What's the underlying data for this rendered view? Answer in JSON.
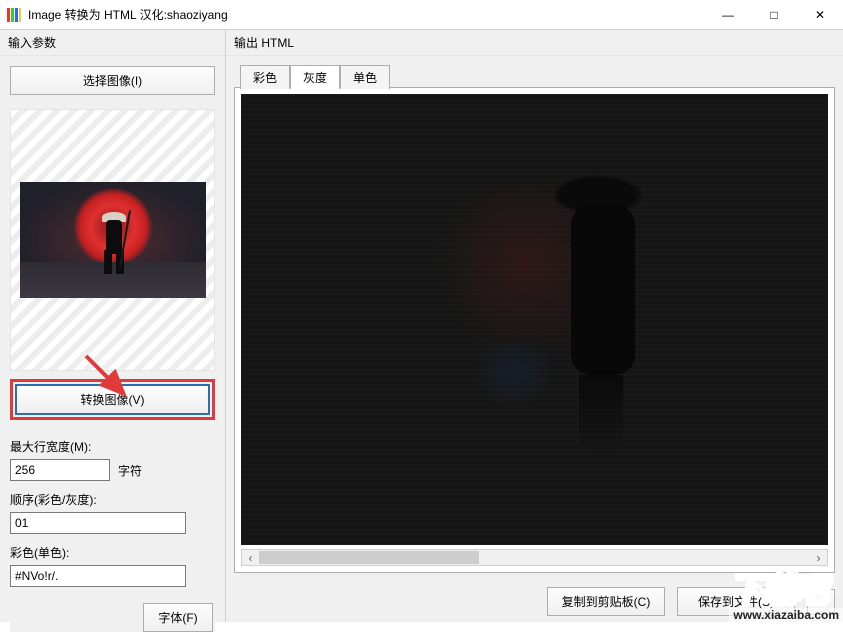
{
  "window": {
    "title": "Image 转换为 HTML   汉化:shaoziyang",
    "buttons": {
      "min": "—",
      "max": "□",
      "close": "✕"
    }
  },
  "left": {
    "header": "输入参数",
    "select_image_btn": "选择图像(I)",
    "convert_btn": "转换图像(V)",
    "max_width_label": "最大行宽度(M):",
    "max_width_value": "256",
    "max_width_suffix": "字符",
    "order_label": "顺序(彩色/灰度):",
    "order_value": "01",
    "color_label": "彩色(单色):",
    "color_value": "#NVo!r/.",
    "font_btn": "字体(F)"
  },
  "right": {
    "header": "输出 HTML",
    "tabs": {
      "color": "彩色",
      "gray": "灰度",
      "mono": "单色"
    },
    "active_tab": "gray",
    "copy_btn": "复制到剪贴板(C)",
    "save_btn": "保存到文件(S)",
    "more_btn": "▸"
  },
  "watermark": {
    "brand": "下载吧",
    "url": "www.xiazaiba.com"
  },
  "hscroll": {
    "left": "‹",
    "right": "›"
  }
}
